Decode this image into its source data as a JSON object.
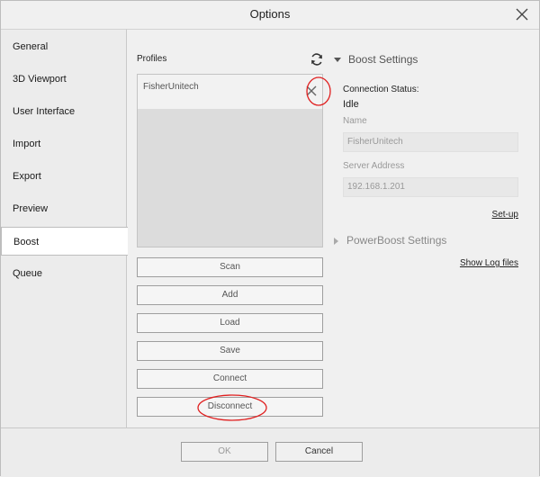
{
  "window": {
    "title": "Options"
  },
  "sidebar": {
    "items": [
      {
        "label": "General"
      },
      {
        "label": "3D Viewport"
      },
      {
        "label": "User Interface"
      },
      {
        "label": "Import"
      },
      {
        "label": "Export"
      },
      {
        "label": "Preview"
      },
      {
        "label": "Boost",
        "active": true
      },
      {
        "label": "Queue"
      }
    ]
  },
  "profiles": {
    "label": "Profiles",
    "items": [
      {
        "name": "FisherUnitech"
      }
    ]
  },
  "buttons": {
    "scan": "Scan",
    "add": "Add",
    "load": "Load",
    "save": "Save",
    "connect": "Connect",
    "disconnect": "Disconnect"
  },
  "boost_settings": {
    "header": "Boost Settings",
    "connection_status_label": "Connection Status:",
    "connection_status_value": "Idle",
    "name_label": "Name",
    "name_value": "FisherUnitech",
    "server_address_label": "Server Address",
    "server_address_value": "192.168.1.201",
    "setup_link": "Set-up"
  },
  "powerboost": {
    "header": "PowerBoost Settings",
    "show_log_link": "Show Log files"
  },
  "footer": {
    "ok": "OK",
    "cancel": "Cancel"
  },
  "colors": {
    "annotation": "#e02020"
  }
}
